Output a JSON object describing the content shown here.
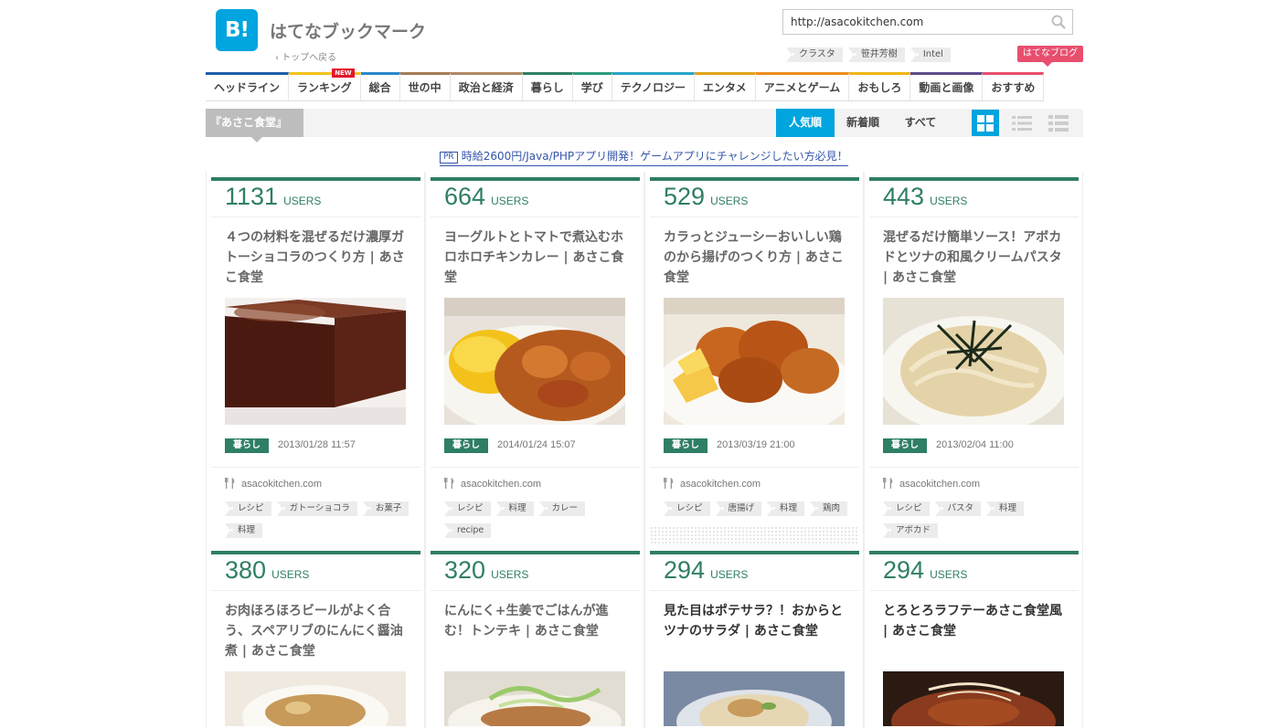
{
  "header": {
    "logo_text": "B!",
    "site_title": "はてなブックマーク",
    "back_link": "‹ トップへ戻る",
    "search_value": "http://asacokitchen.com",
    "top_tags": [
      "クラスタ",
      "笹井芳樹",
      "Intel"
    ],
    "blog_button": "はてなブログ"
  },
  "nav": [
    {
      "label": "ヘッドライン",
      "color": "#1c5ea8"
    },
    {
      "label": "ランキング",
      "color": "#f2c21c",
      "badge": "NEW"
    },
    {
      "label": "総合",
      "color": "#2a86c8"
    },
    {
      "label": "世の中",
      "color": "#a47d56"
    },
    {
      "label": "政治と経済",
      "color": "#b08a63"
    },
    {
      "label": "暮らし",
      "color": "#2f7e66"
    },
    {
      "label": "学び",
      "color": "#2c9a7f"
    },
    {
      "label": "テクノロジー",
      "color": "#29a3c9"
    },
    {
      "label": "エンタメ",
      "color": "#e2a21b"
    },
    {
      "label": "アニメとゲーム",
      "color": "#ef8c1e"
    },
    {
      "label": "おもしろ",
      "color": "#f0b414"
    },
    {
      "label": "動画と画像",
      "color": "#5c4b8a"
    },
    {
      "label": "おすすめ",
      "color": "#e84e6e"
    }
  ],
  "filter": {
    "crumb": "『あさこ食堂』",
    "sort_popular": "人気順",
    "sort_new": "新着順",
    "sort_all": "すべて"
  },
  "pr": {
    "badge": "PR",
    "text": "時給2600円/Java/PHPアプリ開発！ゲームアプリにチャレンジしたい方必見！"
  },
  "cards": [
    {
      "count": "1131",
      "unit": "USERS",
      "title": "４つの材料を混ぜるだけ濃厚ガトーショコラのつくり方 | あさこ食堂",
      "category": "暮らし",
      "date": "2013/01/28 11:57",
      "domain": "asacokitchen.com",
      "tags": [
        "レシピ",
        "ガトーショコラ",
        "お菓子",
        "料理"
      ]
    },
    {
      "count": "664",
      "unit": "USERS",
      "title": "ヨーグルトとトマトで煮込むホロホロチキンカレー | あさこ食堂",
      "category": "暮らし",
      "date": "2014/01/24 15:07",
      "domain": "asacokitchen.com",
      "tags": [
        "レシピ",
        "料理",
        "カレー",
        "recipe"
      ]
    },
    {
      "count": "529",
      "unit": "USERS",
      "title": "カラっとジューシーおいしい鶏のから揚げのつくり方 | あさこ食堂",
      "category": "暮らし",
      "date": "2013/03/19 21:00",
      "domain": "asacokitchen.com",
      "tags": [
        "レシピ",
        "唐揚げ",
        "料理",
        "鶏肉"
      ]
    },
    {
      "count": "443",
      "unit": "USERS",
      "title": "混ぜるだけ簡単ソース！アボカドとツナの和風クリームパスタ | あさこ食堂",
      "category": "暮らし",
      "date": "2013/02/04 11:00",
      "domain": "asacokitchen.com",
      "tags": [
        "レシピ",
        "パスタ",
        "料理",
        "アボカド"
      ]
    },
    {
      "count": "380",
      "unit": "USERS",
      "title": "お肉ほろほろビールがよく合う、スペアリブのにんにく醤油煮 | あさこ食堂"
    },
    {
      "count": "320",
      "unit": "USERS",
      "title": "にんにく+生姜でごはんが進む！トンテキ | あさこ食堂"
    },
    {
      "count": "294",
      "unit": "USERS",
      "title": "見た目はポテサラ？！おからとツナのサラダ | あさこ食堂"
    },
    {
      "count": "294",
      "unit": "USERS",
      "title": "とろとろラフテーあさこ食堂風 | あさこ食堂"
    }
  ]
}
